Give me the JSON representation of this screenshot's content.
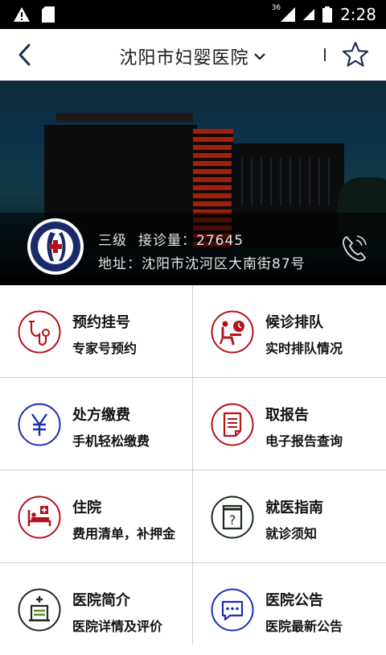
{
  "status_bar": {
    "network": "36",
    "time": "2:28",
    "left_icons": [
      "warning-icon",
      "sd-card-icon"
    ],
    "right_icons": [
      "signal-icon",
      "signal-icon-2",
      "battery-icon"
    ]
  },
  "header": {
    "title": "沈阳市妇婴医院",
    "back_icon": "chevron-left-icon",
    "dropdown_icon": "chevron-down-icon",
    "favorite_icon": "star-outline-icon"
  },
  "hospital": {
    "level": "三级",
    "visits": "接诊量：27645",
    "address": "地址：沈阳市沈河区大南街87号",
    "phone_icon": "phone-icon"
  },
  "menu": [
    {
      "title": "预约挂号",
      "subtitle": "专家号预约",
      "icon": "stethoscope-icon",
      "color": "#b3141c"
    },
    {
      "title": "候诊排队",
      "subtitle": "实时排队情况",
      "icon": "waiting-queue-icon",
      "color": "#b3141c"
    },
    {
      "title": "处方缴费",
      "subtitle": "手机轻松缴费",
      "icon": "yen-icon",
      "color": "#1a2fb5"
    },
    {
      "title": "取报告",
      "subtitle": "电子报告查询",
      "icon": "report-icon",
      "color": "#b3141c"
    },
    {
      "title": "住院",
      "subtitle": "费用清单，补押金",
      "icon": "hospital-bed-icon",
      "color": "#b3141c"
    },
    {
      "title": "就医指南",
      "subtitle": "就诊须知",
      "icon": "guide-book-icon",
      "color": "#1e2a1e"
    },
    {
      "title": "医院简介",
      "subtitle": "医院详情及评价",
      "icon": "hospital-building-icon",
      "color": "#1e2a1e"
    },
    {
      "title": "医院公告",
      "subtitle": "医院最新公告",
      "icon": "announcement-icon",
      "color": "#1a2fb5"
    }
  ]
}
